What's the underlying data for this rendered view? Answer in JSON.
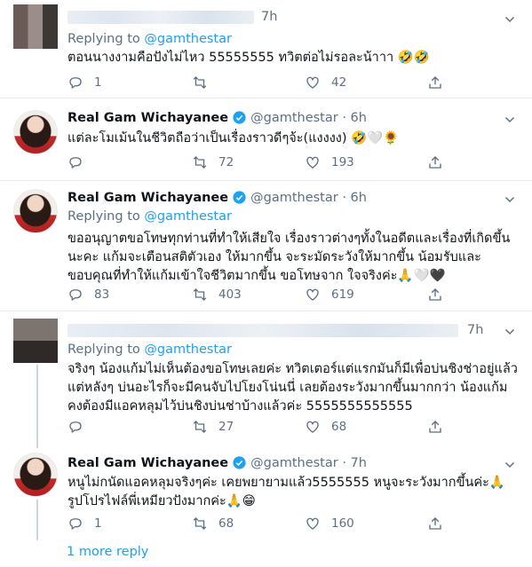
{
  "tweets": [
    {
      "name": "",
      "handle": "",
      "time": "7h",
      "replying_prefix": "Replying to ",
      "replying_to": "@gamthestar",
      "text": "ตอนนางงามคือปังไม่ไหว 55555555 ทวิตต่อไม่รอละน้าาา 🤣🤣",
      "replies": "1",
      "retweets": "",
      "likes": "42"
    },
    {
      "name": "Real Gam Wichayanee",
      "handle": "@gamthestar",
      "time": "6h",
      "text": "แต่ละโมเม้นในชีวิตถือว่าเป็นเรื่องราวดีๆจ้ะ(แงงงง) 🤣🤍🌻",
      "replies": "",
      "retweets": "72",
      "likes": "193"
    },
    {
      "name": "Real Gam Wichayanee",
      "handle": "@gamthestar",
      "time": "6h",
      "replying_prefix": "Replying to ",
      "replying_to": "@gamthestar",
      "text": "ขออนุญาตขอโทษทุกท่านที่ทำให้เสียใจ เรื่องราวต่างๆทั้งในอดีตและเรื่องที่เกิดขึ้นนะคะ แก้มจะเตือนสติตัวเอง ให้มากขึ้น จะระมัดระวังให้มากขึ้น น้อมรับและขอบคุณที่ทำให้แก้มเข้าใจชีวิตมากขึ้น ขอโทษจาก ใจจริงค่ะ🙏🤍🖤",
      "replies": "83",
      "retweets": "403",
      "likes": "619"
    },
    {
      "name": "",
      "handle": "",
      "time": "7h",
      "replying_prefix": "Replying to ",
      "replying_to": "@gamthestar",
      "text": "จริงๆ น้องแก้มไม่เห็นต้องขอโทษเลยค่ะ ทวิตเตอร์แต่แรกมันก็มีเพื่อบ่นชิงช่าอยู่แล้ว แต่หลังๆ บ่นอะไรก็จะมีคนจับไปโยงโน่นนี่ เลยต้องระวังมากขึ้นมากกว่า น้องแก้มคงต้องมีแอคหลุมไว้บ่นชิงบ่นช่าบ้างแล้วค่ะ 5555555555555",
      "replies": "",
      "retweets": "27",
      "likes": "68"
    },
    {
      "name": "Real Gam Wichayanee",
      "handle": "@gamthestar",
      "time": "7h",
      "text": "หนูไม่กนัดแอคหลุมจริงๆค่ะ เคยพยายามแล้ว5555555 หนูจะระวังมากขึ้นค่ะ🙏 รูปโปรไฟล์พี่เหมียวปังมากค่ะ🙏😁",
      "replies": "1",
      "retweets": "68",
      "likes": "160"
    }
  ],
  "more_replies": "1 more reply",
  "colors": {
    "accent": "#1da1f2",
    "muted": "#5b7083",
    "divider": "#e6ecf0",
    "verified": "#1da1f2"
  },
  "icons": [
    "more-icon",
    "verified-icon",
    "reply-icon",
    "retweet-icon",
    "like-icon",
    "share-icon"
  ]
}
